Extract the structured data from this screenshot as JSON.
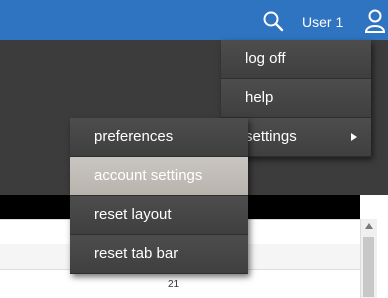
{
  "header": {
    "user_name": "User 1",
    "search_icon": "search-icon",
    "user_icon": "user-icon",
    "bar_color": "#2f74c0"
  },
  "user_menu": {
    "items": [
      {
        "label": "log off"
      },
      {
        "label": "help"
      },
      {
        "label": "settings",
        "has_submenu": true
      }
    ]
  },
  "settings_menu": {
    "items": [
      {
        "label": "preferences",
        "highlighted": false
      },
      {
        "label": "account settings",
        "highlighted": true
      },
      {
        "label": "reset layout",
        "highlighted": false
      },
      {
        "label": "reset tab bar",
        "highlighted": false
      }
    ]
  },
  "content": {
    "row_number": "21"
  }
}
